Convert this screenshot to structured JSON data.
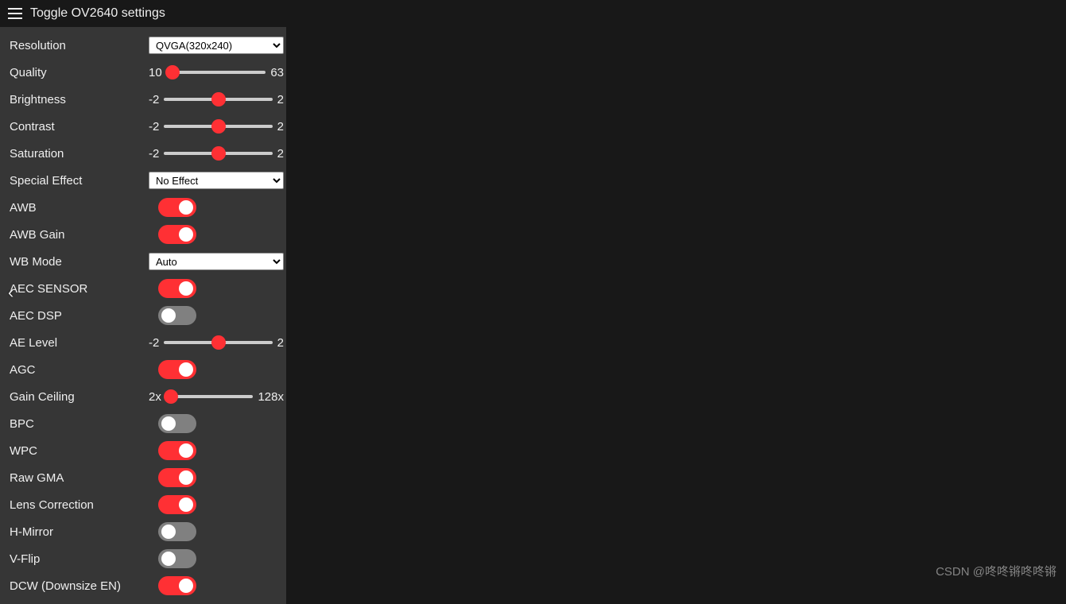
{
  "header": {
    "title": "Toggle OV2640 settings"
  },
  "settings": {
    "resolution": {
      "label": "Resolution",
      "value": "QVGA(320x240)"
    },
    "quality": {
      "label": "Quality",
      "min": "10",
      "max": "63",
      "pos": 6
    },
    "brightness": {
      "label": "Brightness",
      "min": "-2",
      "max": "2",
      "pos": 50
    },
    "contrast": {
      "label": "Contrast",
      "min": "-2",
      "max": "2",
      "pos": 50
    },
    "saturation": {
      "label": "Saturation",
      "min": "-2",
      "max": "2",
      "pos": 50
    },
    "special_effect": {
      "label": "Special Effect",
      "value": "No Effect"
    },
    "awb": {
      "label": "AWB",
      "on": true
    },
    "awb_gain": {
      "label": "AWB Gain",
      "on": true
    },
    "wb_mode": {
      "label": "WB Mode",
      "value": "Auto"
    },
    "aec_sensor": {
      "label": "AEC SENSOR",
      "on": true
    },
    "aec_dsp": {
      "label": "AEC DSP",
      "on": false
    },
    "ae_level": {
      "label": "AE Level",
      "min": "-2",
      "max": "2",
      "pos": 50
    },
    "agc": {
      "label": "AGC",
      "on": true
    },
    "gain_ceiling": {
      "label": "Gain Ceiling",
      "min": "2x",
      "max": "128x",
      "pos": 6
    },
    "bpc": {
      "label": "BPC",
      "on": false
    },
    "wpc": {
      "label": "WPC",
      "on": true
    },
    "raw_gma": {
      "label": "Raw GMA",
      "on": true
    },
    "lens_correction": {
      "label": "Lens Correction",
      "on": true
    },
    "h_mirror": {
      "label": "H-Mirror",
      "on": false
    },
    "v_flip": {
      "label": "V-Flip",
      "on": false
    },
    "dcw": {
      "label": "DCW (Downsize EN)",
      "on": true
    }
  },
  "watermark": "CSDN @咚咚锵咚咚锵"
}
